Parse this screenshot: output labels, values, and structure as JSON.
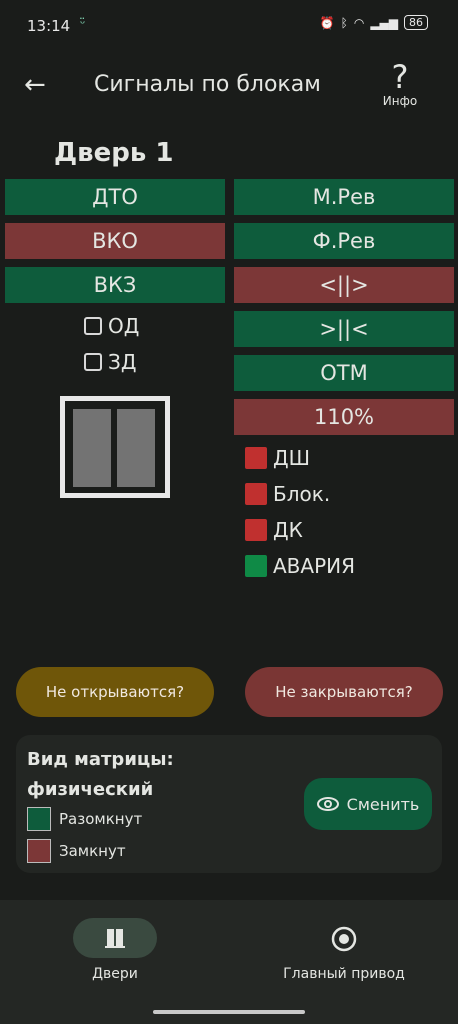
{
  "status_bar": {
    "time": "13:14",
    "battery": "86"
  },
  "header": {
    "title": "Сигналы по блокам",
    "info_label": "Инфо"
  },
  "door": {
    "title": "Дверь 1"
  },
  "left_signals": [
    {
      "label": "ДТО",
      "state": "green"
    },
    {
      "label": "ВКО",
      "state": "red"
    },
    {
      "label": "ВКЗ",
      "state": "green"
    }
  ],
  "checkboxes": [
    {
      "label": "ОД"
    },
    {
      "label": "ЗД"
    }
  ],
  "right_signals": [
    {
      "label": "М.Рев",
      "state": "green"
    },
    {
      "label": "Ф.Рев",
      "state": "green"
    },
    {
      "label": "<||>",
      "state": "red"
    },
    {
      "label": ">||<",
      "state": "green"
    },
    {
      "label": "ОТМ",
      "state": "green"
    },
    {
      "label": "110%",
      "state": "red"
    }
  ],
  "indicators": [
    {
      "label": "ДШ",
      "color": "#c0302f"
    },
    {
      "label": "Блок.",
      "color": "#c0302f"
    },
    {
      "label": "ДК",
      "color": "#c0302f"
    },
    {
      "label": "АВАРИЯ",
      "color": "#0f8a46"
    }
  ],
  "actions": {
    "not_open": "Не открываются?",
    "not_close": "Не закрываются?"
  },
  "matrix": {
    "heading": "Вид матрицы:",
    "mode": "физический",
    "legend_open": "Разомкнут",
    "legend_closed": "Замкнут",
    "switch_label": "Сменить"
  },
  "bottom_nav": {
    "doors": "Двери",
    "main_drive": "Главный привод"
  },
  "colors": {
    "green": "#0e5c3c",
    "red": "#7c3737",
    "bg": "#1a1c1a",
    "yellow_pill": "#6f5609",
    "red_pill": "#7a3634"
  }
}
